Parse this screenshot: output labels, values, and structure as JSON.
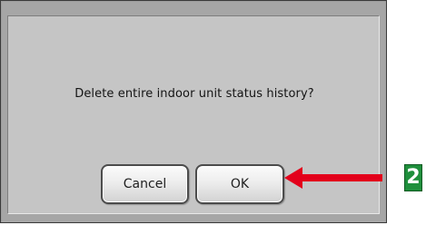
{
  "dialog": {
    "message": "Delete entire indoor unit status history?",
    "buttons": {
      "cancel_label": "Cancel",
      "ok_label": "OK"
    }
  },
  "annotation": {
    "step_number": "2",
    "arrow_icon": "left-arrow-icon",
    "colors": {
      "arrow": "#e3001b",
      "badge_background": "#1f8f3c",
      "badge_text": "#ffffff"
    }
  },
  "colors": {
    "dialog_frame": "#a6a6a6",
    "dialog_panel": "#c5c5c5",
    "button_border": "#4c4c4c"
  }
}
